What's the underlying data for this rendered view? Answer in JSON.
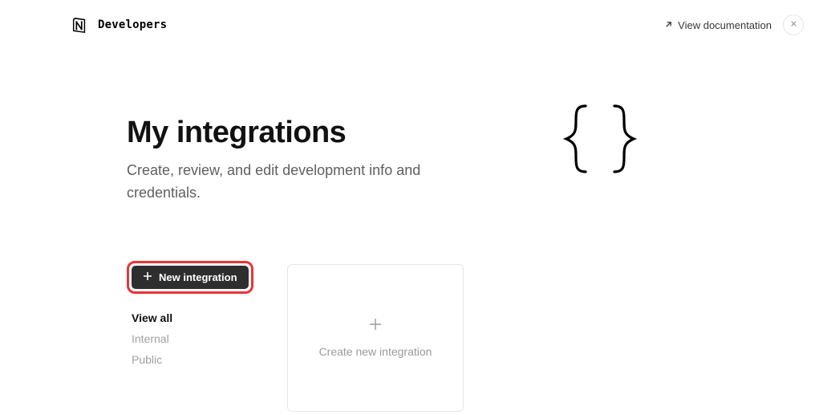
{
  "header": {
    "title": "Developers",
    "doc_link": "View documentation"
  },
  "page": {
    "title": "My integrations",
    "subtitle": "Create, review, and edit development info and credentials."
  },
  "actions": {
    "new_integration": "New integration"
  },
  "filters": {
    "view_all": "View all",
    "internal": "Internal",
    "public": "Public"
  },
  "card": {
    "create_label": "Create new integration"
  }
}
